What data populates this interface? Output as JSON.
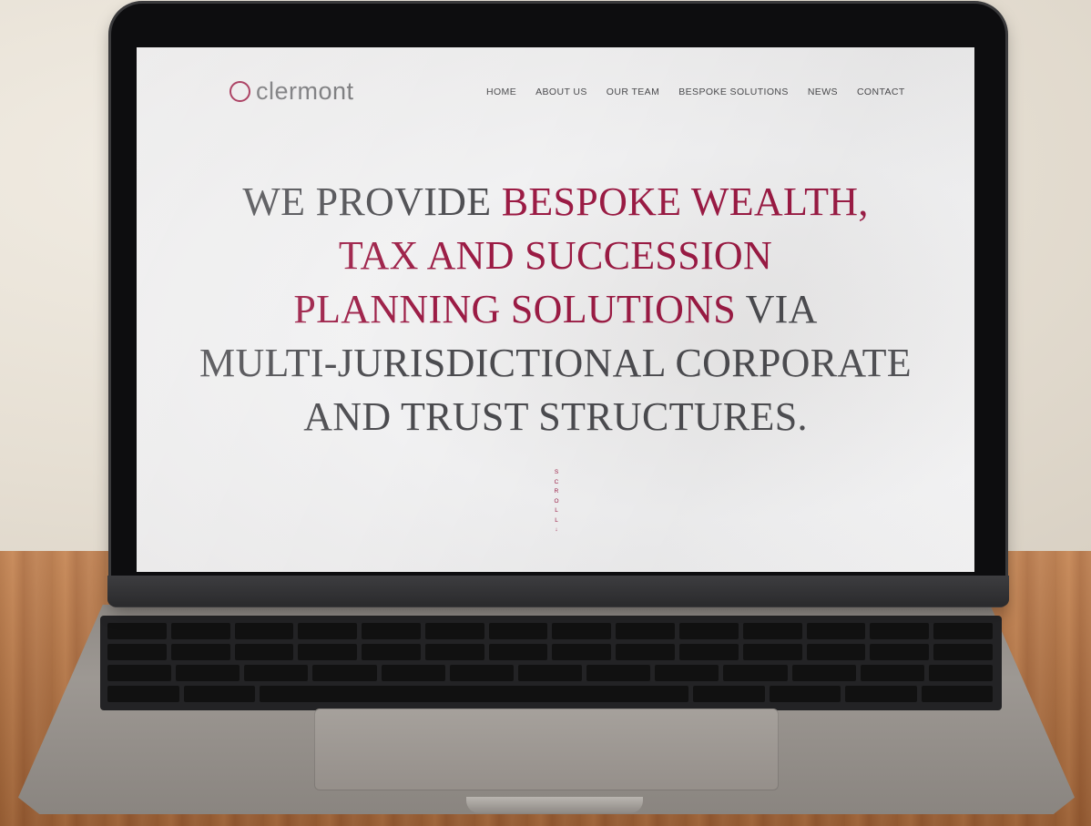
{
  "site": {
    "logo_text": "clermont",
    "nav": [
      "HOME",
      "ABOUT US",
      "OUR TEAM",
      "BESPOKE SOLUTIONS",
      "NEWS",
      "CONTACT"
    ],
    "hero": {
      "line1_plain": "WE PROVIDE ",
      "line1_accent": "BESPOKE WEALTH,",
      "line2_accent": "TAX AND SUCCESSION",
      "line3_accent": "PLANNING SOLUTIONS",
      "line3_plain": " VIA",
      "line4": "MULTI-JURISDICTIONAL CORPORATE",
      "line5": "AND TRUST STRUCTURES."
    },
    "scroll_letters": [
      "S",
      "C",
      "R",
      "O",
      "L",
      "L"
    ],
    "scroll_arrow": "↓"
  },
  "colors": {
    "accent": "#9b1b44",
    "text": "#4b4b4f"
  },
  "icons": {
    "logo": "circle-ring-icon",
    "scroll": "arrow-down-icon"
  }
}
